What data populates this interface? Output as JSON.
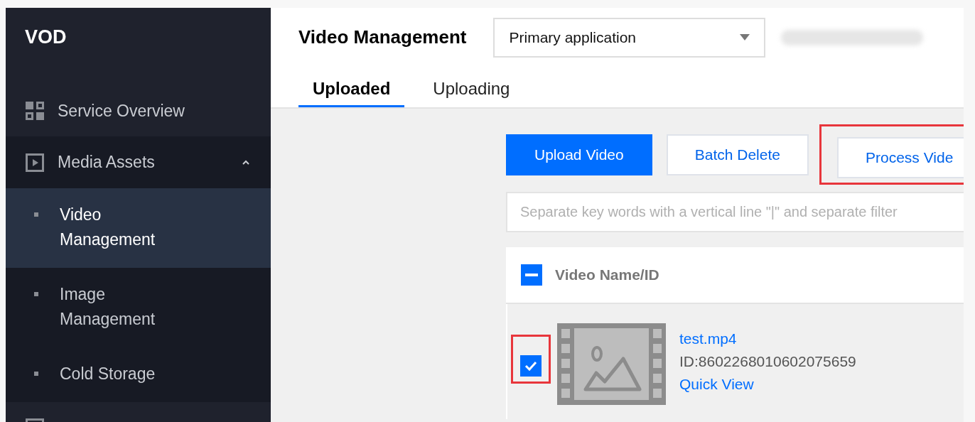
{
  "sidebar": {
    "title": "VOD",
    "items": [
      {
        "label": "Service Overview",
        "selected": false
      },
      {
        "label": "Media Assets",
        "selected": false,
        "expanded": true,
        "children": [
          {
            "label": "Video Management",
            "selected": true
          },
          {
            "label": "Image Management",
            "selected": false
          },
          {
            "label": "Cold Storage",
            "selected": false
          }
        ]
      },
      {
        "selected": false
      }
    ]
  },
  "header": {
    "title": "Video Management",
    "app_select": {
      "value": "Primary application"
    },
    "tabs": [
      {
        "label": "Uploaded",
        "selected": true
      },
      {
        "label": "Uploading",
        "selected": false
      }
    ]
  },
  "toolbar": {
    "buttons": [
      {
        "label": "Upload Video",
        "kind": "primary",
        "highlighted": false
      },
      {
        "label": "Batch Delete",
        "kind": "default",
        "highlighted": false
      },
      {
        "label": "Process Vide",
        "kind": "default",
        "highlighted": true
      }
    ]
  },
  "search": {
    "placeholder": "Separate key words with a vertical line \"|\" and separate filter"
  },
  "table": {
    "columns": [
      "Video Name/ID"
    ],
    "header_checkbox": {
      "indeterminate": true
    },
    "rows": [
      {
        "checked": true,
        "highlighted": true,
        "name": "test.mp4",
        "id": "ID:8602268010602075659",
        "link": "Quick View"
      }
    ]
  }
}
